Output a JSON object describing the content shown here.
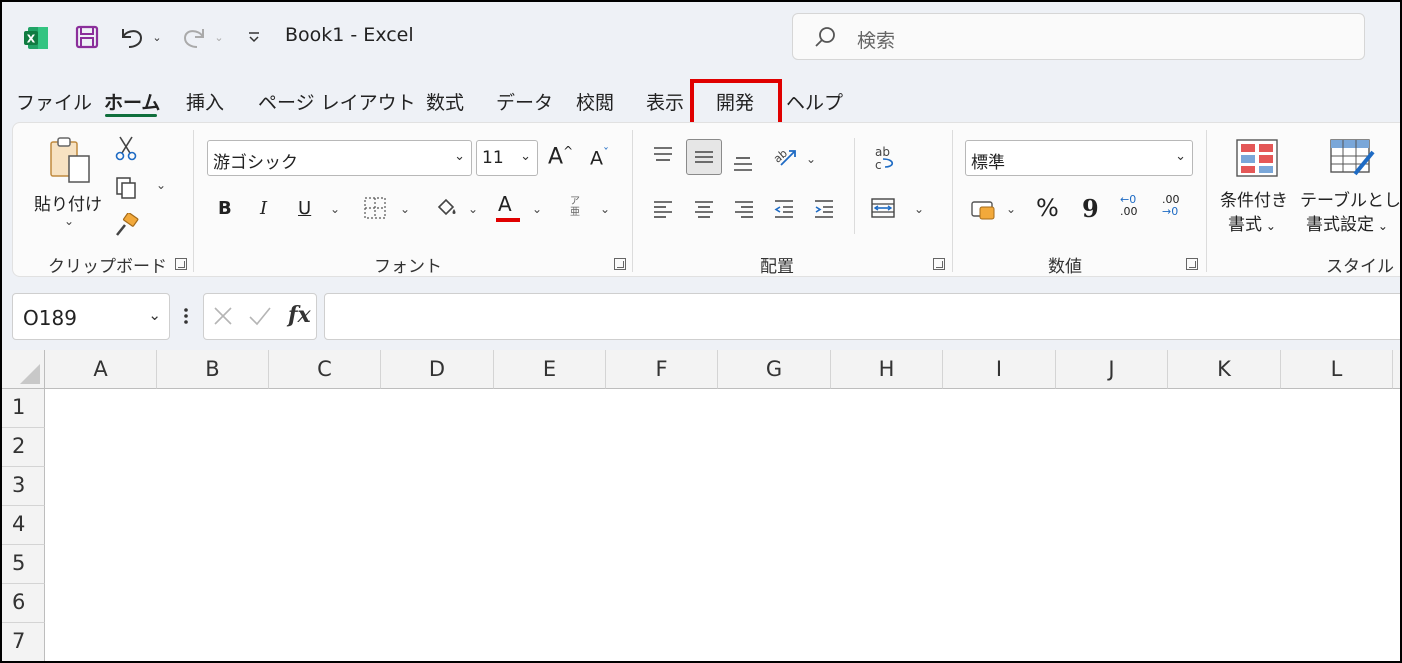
{
  "titlebar": {
    "app_icon": "excel-icon",
    "save_icon": "save-icon",
    "undo_icon": "undo-icon",
    "redo_icon": "redo-icon",
    "customize_icon": "customize-qat-icon",
    "title": "Book1  -  Excel",
    "search": {
      "placeholder": "検索",
      "icon": "search-icon"
    }
  },
  "tabs": [
    {
      "label": "ファイル"
    },
    {
      "label": "ホーム",
      "active": true
    },
    {
      "label": "挿入"
    },
    {
      "label": "ページ レイアウト"
    },
    {
      "label": "数式"
    },
    {
      "label": "データ"
    },
    {
      "label": "校閲"
    },
    {
      "label": "表示"
    },
    {
      "label": "開発",
      "highlighted": true,
      "highlight_color": "#e00000"
    },
    {
      "label": "ヘルプ"
    }
  ],
  "ribbon": {
    "clipboard": {
      "label": "クリップボード",
      "paste_label": "貼り付け",
      "icons": [
        "paste-icon",
        "cut-icon",
        "copy-icon",
        "format-painter-icon"
      ]
    },
    "font": {
      "label": "フォント",
      "font_name": "游ゴシック",
      "font_size": "11",
      "increase_label": "A",
      "decrease_label": "A",
      "bold_label": "B",
      "italic_label": "I",
      "underline_label": "U",
      "font_color_label": "A",
      "font_color": "#e00000",
      "phonetic_label": "ア亜"
    },
    "alignment": {
      "label": "配置",
      "wrap_label": "ab"
    },
    "number": {
      "label": "数値",
      "format": "標準",
      "percent_label": "%",
      "comma_label": "9",
      "increase_decimal_top": "←0",
      "increase_decimal_bottom": ".00",
      "decrease_decimal_top": ".00",
      "decrease_decimal_bottom": "→0"
    },
    "styles": {
      "label": "スタイル",
      "conditional_line1": "条件付き",
      "conditional_line2": "書式",
      "table_line1": "テーブルとして",
      "table_line2": "書式設定"
    }
  },
  "formula_bar": {
    "name_box": "O189",
    "cancel_icon": "cancel-icon",
    "enter_icon": "enter-icon",
    "fx_label": "fx",
    "formula": ""
  },
  "sheet": {
    "columns": [
      "A",
      "B",
      "C",
      "D",
      "E",
      "F",
      "G",
      "H",
      "I",
      "J",
      "K",
      "L"
    ],
    "rows": [
      "1",
      "2",
      "3",
      "4",
      "5",
      "6",
      "7"
    ]
  }
}
